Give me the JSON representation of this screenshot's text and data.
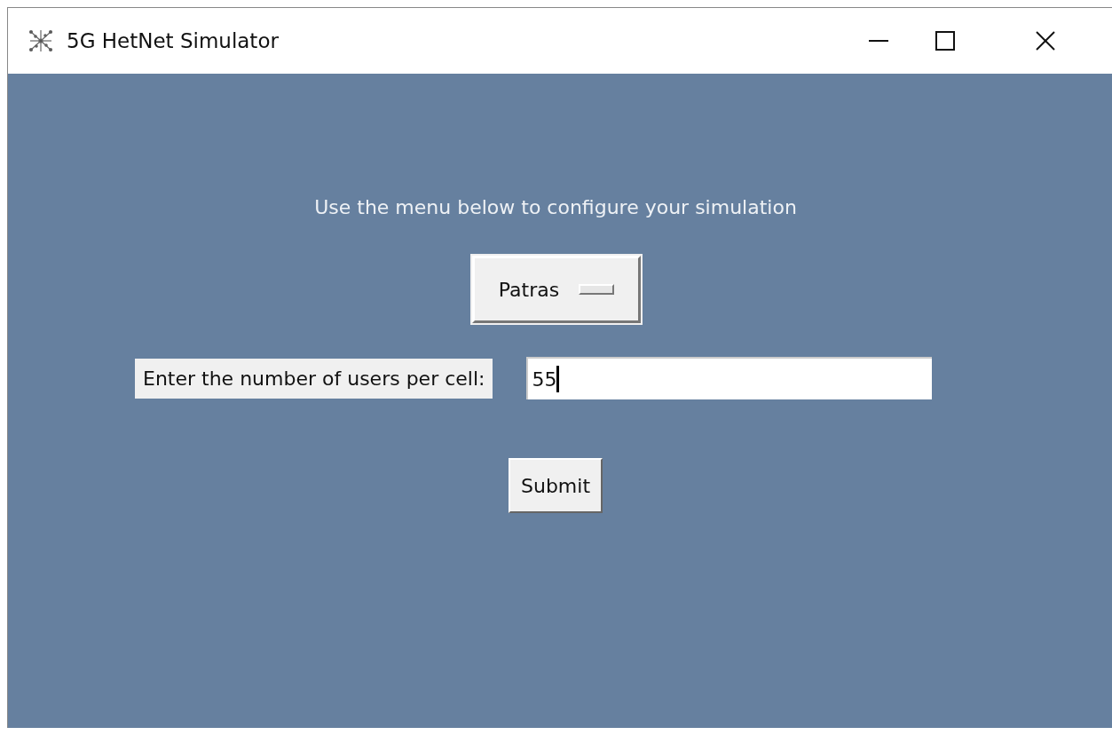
{
  "window": {
    "title": "5G HetNet Simulator"
  },
  "instruction": "Use the menu below to configure your simulation",
  "city_menu": {
    "value": "Patras"
  },
  "users_field": {
    "label": "Enter the number of users per cell:",
    "value": "55"
  },
  "buttons": [
    "Submit"
  ]
}
